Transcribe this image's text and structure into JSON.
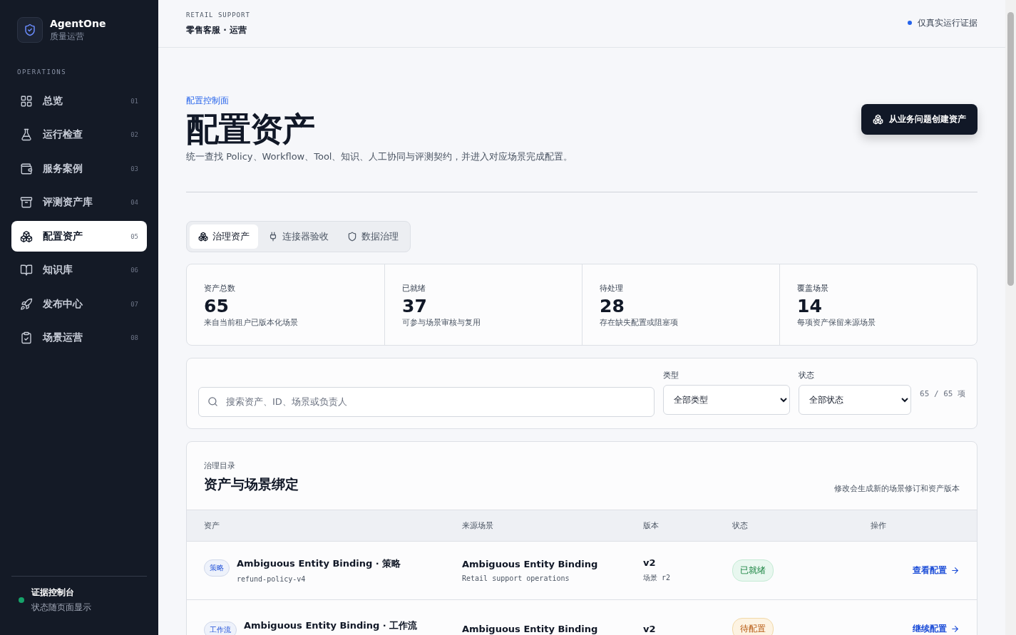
{
  "brand": {
    "name": "AgentOne",
    "subtitle": "质量运营"
  },
  "nav": {
    "section_label": "OPERATIONS",
    "items": [
      {
        "label": "总览",
        "number": "01",
        "selected": false
      },
      {
        "label": "运行检查",
        "number": "02",
        "selected": false
      },
      {
        "label": "服务案例",
        "number": "03",
        "selected": false
      },
      {
        "label": "评测资产库",
        "number": "04",
        "selected": false
      },
      {
        "label": "配置资产",
        "number": "05",
        "selected": true
      },
      {
        "label": "知识库",
        "number": "06",
        "selected": false
      },
      {
        "label": "发布中心",
        "number": "07",
        "selected": false
      },
      {
        "label": "场景运营",
        "number": "08",
        "selected": false
      }
    ]
  },
  "sidebar_footer": {
    "title": "证据控制台",
    "subtitle": "状态随页面显示"
  },
  "header": {
    "eyebrow": "RETAIL SUPPORT",
    "title": "零售客服 · 运营",
    "badge": "仅真实运行证据"
  },
  "page": {
    "eyebrow": "配置控制面",
    "title": "配置资产",
    "description": "统一查找 Policy、Workflow、Tool、知识、人工协同与评测契约，并进入对应场景完成配置。",
    "create_button": "从业务问题创建资产"
  },
  "tabs": [
    {
      "label": "治理资产",
      "selected": true
    },
    {
      "label": "连接器验收",
      "selected": false
    },
    {
      "label": "数据治理",
      "selected": false
    }
  ],
  "stats": [
    {
      "label": "资产总数",
      "value": "65",
      "note": "来自当前租户已版本化场景"
    },
    {
      "label": "已就绪",
      "value": "37",
      "note": "可参与场景审核与复用"
    },
    {
      "label": "待处理",
      "value": "28",
      "note": "存在缺失配置或阻塞项"
    },
    {
      "label": "覆盖场景",
      "value": "14",
      "note": "每项资产保留来源场景"
    }
  ],
  "filters": {
    "search_placeholder": "搜索资产、ID、场景或负责人",
    "type_label": "类型",
    "type_value": "全部类型",
    "status_label": "状态",
    "status_value": "全部状态",
    "count": "65 / 65 项"
  },
  "catalog": {
    "eyebrow": "治理目录",
    "title": "资产与场景绑定",
    "note": "修改会生成新的场景修订和资产版本",
    "columns": [
      "资产",
      "来源场景",
      "版本",
      "状态",
      "操作"
    ],
    "rows": [
      {
        "tag": "策略",
        "name": "Ambiguous Entity Binding · 策略",
        "id": "refund-policy-v4",
        "source": "Ambiguous Entity Binding",
        "source_sub": "Retail support operations",
        "version": "v2",
        "version_sub": "场景 r2",
        "status": "已就绪",
        "kind": "ready",
        "action": "查看配置"
      },
      {
        "tag": "工作流",
        "name": "Ambiguous Entity Binding · 工作流",
        "source": "Ambiguous Entity Binding",
        "version": "v2",
        "status": "待配置",
        "kind": "pending",
        "action": "继续配置"
      }
    ]
  }
}
